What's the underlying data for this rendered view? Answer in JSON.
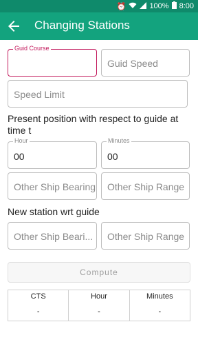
{
  "status": {
    "battery": "100%",
    "time": "8:00"
  },
  "appbar": {
    "title": "Changing Stations"
  },
  "form": {
    "guid_course_label": "Guid Course",
    "guid_speed_placeholder": "Guid Speed",
    "speed_limit_placeholder": "Speed Limit",
    "section1_text": "Present position with respect to guide at time t",
    "hour_label": "Hour",
    "hour_value": "00",
    "minutes_label": "Minutes",
    "minutes_value": "00",
    "bearing1_placeholder": "Other Ship Bearing",
    "range1_placeholder": "Other Ship Range",
    "section2_text": "New station wrt guide",
    "bearing2_placeholder": "Other Ship Beari...",
    "range2_placeholder": "Other Ship Range"
  },
  "compute_label": "Compute",
  "results": {
    "headers": [
      "CTS",
      "Hour",
      "Minutes"
    ],
    "values": [
      "-",
      "-",
      "-"
    ]
  },
  "colors": {
    "status_bar": "#0f8a6b",
    "app_bar": "#13a37e",
    "focus": "#c2185b"
  }
}
